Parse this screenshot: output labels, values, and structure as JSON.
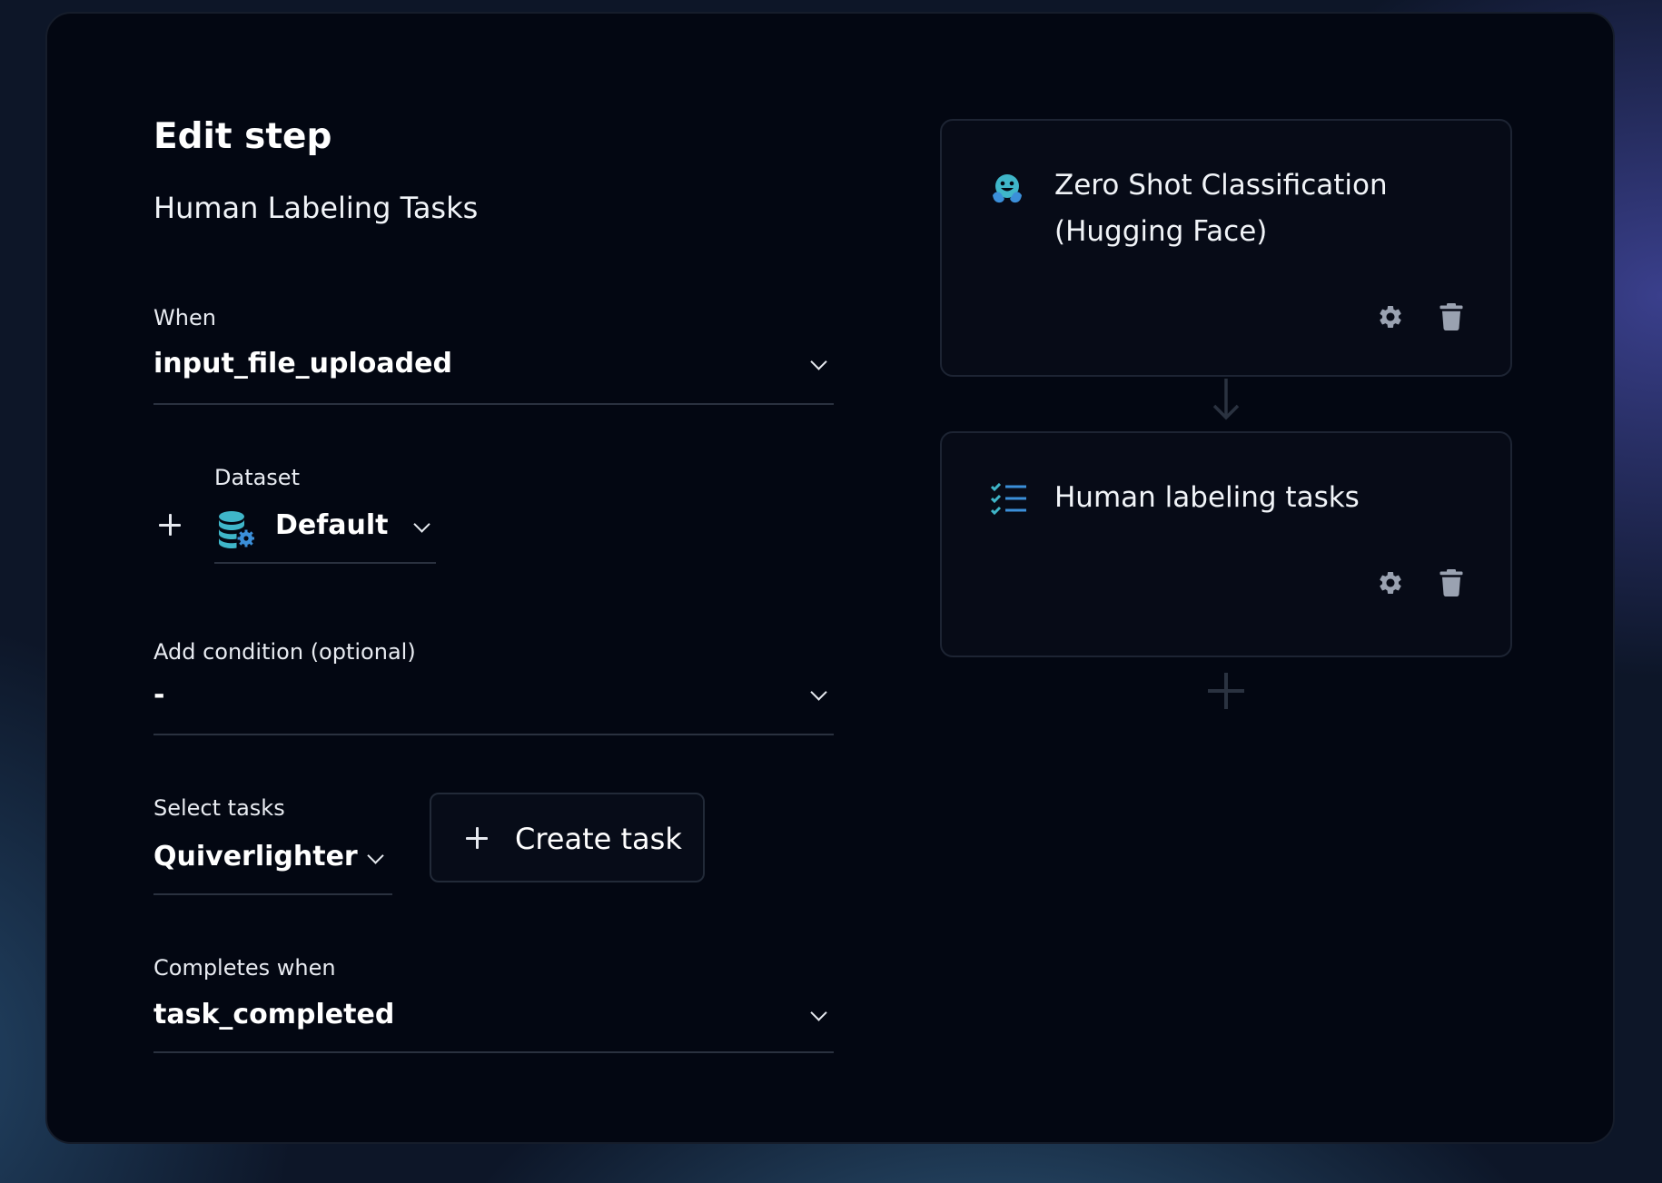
{
  "dialog": {
    "title": "Edit step",
    "subtitle": "Human Labeling Tasks"
  },
  "form": {
    "when": {
      "label": "When",
      "value": "input_file_uploaded"
    },
    "dataset": {
      "label": "Dataset",
      "value": "Default",
      "icon": "database-gear-icon"
    },
    "condition": {
      "label": "Add condition (optional)",
      "value": "-"
    },
    "tasks": {
      "label": "Select tasks",
      "value": "Quiverlighter"
    },
    "create_task": {
      "label": "Create task"
    },
    "completes": {
      "label": "Completes when",
      "value": "task_completed"
    }
  },
  "pipeline": {
    "steps": [
      {
        "title": "Zero Shot Classification (Hugging Face)",
        "icon": "hugging-face-icon"
      },
      {
        "title": "Human labeling tasks",
        "icon": "checklist-icon"
      }
    ]
  },
  "colors": {
    "accent_teal": "#3fb6c9",
    "accent_blue": "#3b8fd9",
    "icon_gray": "#9aa2b1",
    "panel_bg": "#030712"
  }
}
